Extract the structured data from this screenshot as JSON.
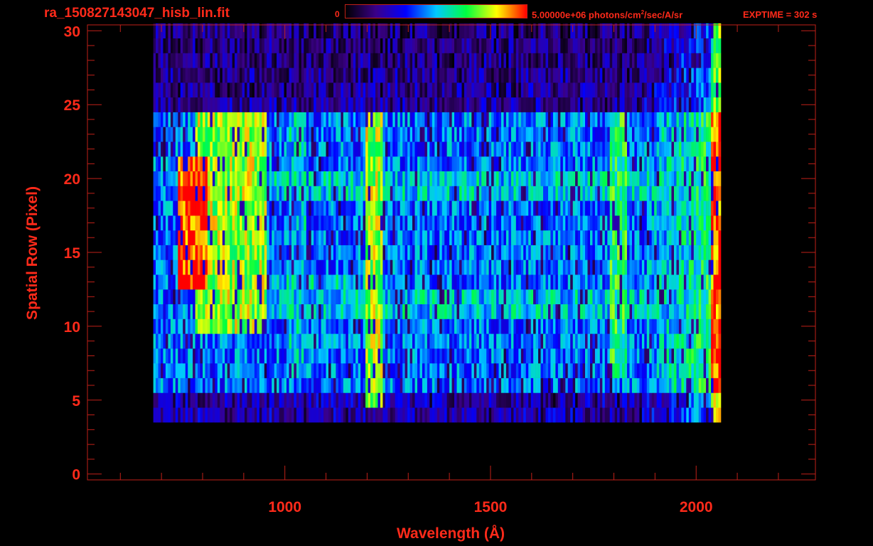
{
  "header": {
    "file_title": "ra_150827143047_hisb_lin.fit",
    "colorbar_min_label": "0",
    "colorbar_max_value": "5.00000e+06 photons/cm",
    "colorbar_max_exponent": "2",
    "colorbar_max_unit_tail": "/sec/A/sr",
    "exptime_label": "EXPTIME = 302 s"
  },
  "colors": {
    "text": "#ff2a1a",
    "axis": "#c02018",
    "background": "#000000",
    "colormap": [
      "#000000",
      "#3a0088",
      "#0000ff",
      "#00c8ff",
      "#00ff40",
      "#ffff00",
      "#ff0000"
    ]
  },
  "chart_data": {
    "type": "heatmap",
    "title": "ra_150827143047_hisb_lin.fit",
    "xlabel": "Wavelength (Å)",
    "ylabel": "Spatial Row (Pixel)",
    "xlim": [
      520,
      2290
    ],
    "ylim": [
      -0.4,
      30.4
    ],
    "x_ticks": [
      1000,
      1500,
      2000
    ],
    "y_ticks": [
      0,
      5,
      10,
      15,
      20,
      25,
      30
    ],
    "colorbar": {
      "min": 0,
      "max": 5000000,
      "unit": "photons/cm^2/sec/A/sr",
      "colormap": "rainbow"
    },
    "grid": false,
    "data_extent": {
      "x": [
        680,
        2060
      ],
      "rows": [
        4,
        30
      ]
    },
    "features": [
      {
        "label": "red emission band",
        "x_range": [
          735,
          810
        ],
        "rows": [
          13,
          21
        ],
        "level": "max"
      },
      {
        "label": "yellow-green arc",
        "x_range": [
          780,
          950
        ],
        "rows": [
          10,
          24
        ],
        "level": "high"
      },
      {
        "label": "bright vertical line",
        "x": 1215,
        "rows": [
          5,
          24
        ],
        "level": "high"
      },
      {
        "label": "cyan vertical line",
        "x": 1030,
        "rows": [
          7,
          24
        ],
        "level": "medium"
      },
      {
        "label": "green vertical band",
        "x": 1810,
        "rows": [
          7,
          24
        ],
        "level": "medium-high"
      },
      {
        "label": "cyan horizontal band",
        "rows": [
          11,
          12
        ],
        "x_range": [
          880,
          2060
        ],
        "level": "medium"
      },
      {
        "label": "cyan horizontal band",
        "rows": [
          19,
          20
        ],
        "x_range": [
          830,
          2060
        ],
        "level": "medium"
      },
      {
        "label": "cyan horizontal band",
        "rows": [
          13,
          13
        ],
        "x_range": [
          810,
          1220
        ],
        "level": "medium"
      }
    ]
  }
}
